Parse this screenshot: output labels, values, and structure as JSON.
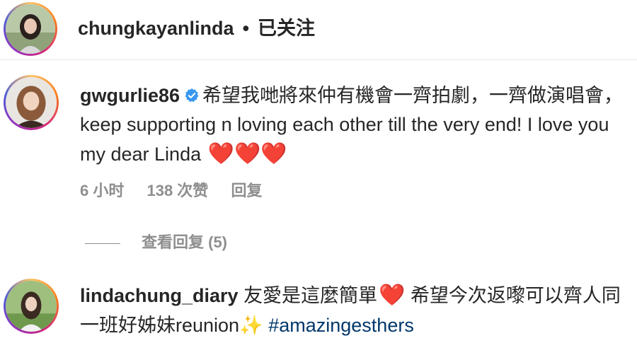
{
  "header": {
    "username": "chungkayanlinda",
    "separator": "•",
    "follow_status": "已关注"
  },
  "comments": [
    {
      "username": "gwgurlie86",
      "verified": true,
      "text": "希望我哋將來仲有機會一齊拍劇，一齊做演唱會，keep supporting n loving each other till the very end! I love you my dear Linda",
      "emoji": "❤️❤️❤️",
      "time": "6 小时",
      "likes": "138 次赞",
      "reply_label": "回复",
      "view_replies": "查看回复 (5)"
    },
    {
      "username": "lindachung_diary",
      "verified": false,
      "text_part1": "友愛是這麼簡單",
      "emoji1": "❤️",
      "text_part2": "希望今次返嚟可以齊人同一班好姊妹reunion",
      "emoji2": "✨",
      "hashtag": "#amazingesthers"
    }
  ],
  "colors": {
    "primary_text": "#262626",
    "secondary_text": "#8e8e8e",
    "hashtag": "#00376b",
    "verified_badge": "#3897f0",
    "heart": "#e0245e"
  }
}
